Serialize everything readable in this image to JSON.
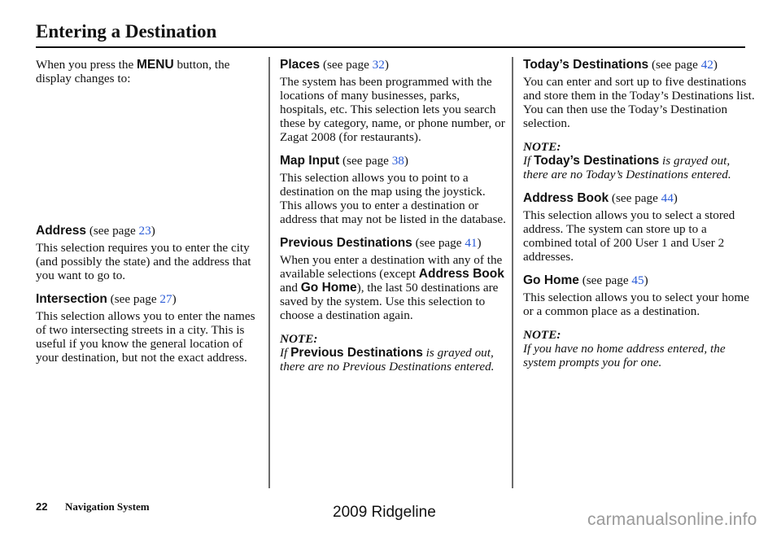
{
  "header": {
    "title": "Entering a Destination"
  },
  "intro": {
    "before": "When you press the ",
    "keyword": "MENU",
    "after": " button, the display changes to:"
  },
  "see_page_prefix": "(see page ",
  "see_page_suffix": ")",
  "colors": {
    "link": "#2a5bd7",
    "divider": "#6b6b6b",
    "watermark": "#9a9a9a"
  },
  "sections": {
    "address": {
      "label": "Address",
      "page": "23",
      "body": "This selection requires you to enter the city (and possibly the state) and the address that you want to go to."
    },
    "intersection": {
      "label": "Intersection",
      "page": "27",
      "body": "This selection allows you to enter the names of two intersecting streets in a city. This is useful if you know the general location of your destination, but not the exact address."
    },
    "places": {
      "label": "Places",
      "page": "32",
      "body": "The system has been programmed with the locations of many businesses, parks, hospitals, etc. This selection lets you search these by category, name, or phone number, or Zagat 2008 (for restaurants)."
    },
    "map_input": {
      "label": "Map Input",
      "page": "38",
      "body": "This selection allows you to point to a destination on the map using the joystick. This allows you to enter a destination or address that may not be listed in the database."
    },
    "previous_destinations": {
      "label": "Previous Destinations",
      "page": "41",
      "body_1": "When you enter a destination with any of the available selections (except ",
      "kw_1": "Address Book",
      "body_2": " and ",
      "kw_2": "Go Home",
      "body_3": "), the last 50 destinations are saved by the system. Use this selection to choose a destination again.",
      "note_head": "NOTE:",
      "note_if": "If ",
      "note_kw": "Previous Destinations",
      "note_rest": " is grayed out, there are no Previous Destinations entered."
    },
    "todays_destinations": {
      "label": "Today’s Destinations",
      "page": "42",
      "body": "You can enter and sort up to five destinations and store them in the Today’s Destinations list. You can then use the Today’s Destination selection.",
      "note_head": "NOTE:",
      "note_if": "If ",
      "note_kw": "Today’s Destinations",
      "note_rest": " is grayed out, there are no Today’s Destinations entered."
    },
    "address_book": {
      "label": "Address Book",
      "page": "44",
      "body": "This selection allows you to select a stored address. The system can store up to a combined total of  200 User 1 and User 2 addresses."
    },
    "go_home": {
      "label": "Go Home",
      "page": "45",
      "body": "This selection allows you to select your home or a common place as a destination.",
      "note_head": "NOTE:",
      "note_body": "If you have no home address entered, the system prompts you for one."
    }
  },
  "footer": {
    "page_number": "22",
    "section_name": "Navigation System",
    "model": "2009  Ridgeline",
    "watermark": "carmanualsonline.info"
  }
}
